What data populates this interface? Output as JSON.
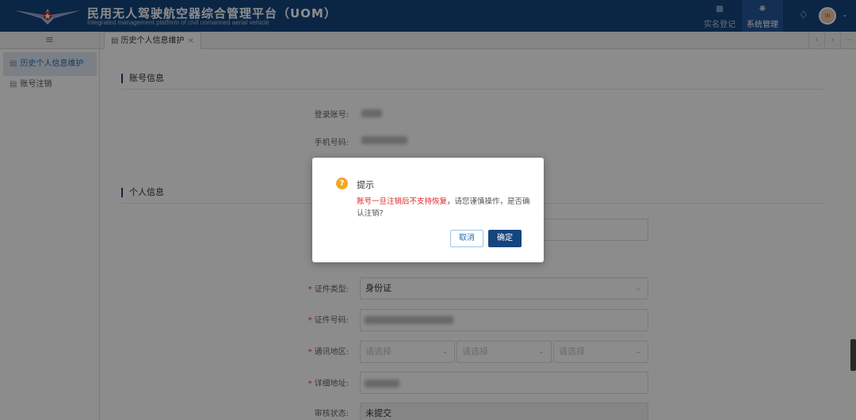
{
  "header": {
    "title": "民用无人驾驶航空器综合管理平台（UOM）",
    "subtitle": "Integrated management platform of civil unmanned aerial vehicle",
    "nav": [
      {
        "label": "实名登记",
        "icon": "document-icon"
      },
      {
        "label": "系统管理",
        "icon": "network-icon"
      }
    ],
    "avatar_initial": "w"
  },
  "tabs": [
    {
      "label": "历史个人信息维护"
    }
  ],
  "sidebar": {
    "items": [
      {
        "label": "历史个人信息维护"
      },
      {
        "label": "账号注销"
      }
    ]
  },
  "form": {
    "account_section": "账号信息",
    "personal_section": "个人信息",
    "login_label": "登录账号:",
    "phone_label": "手机号码:",
    "id_type_label": "证件类型:",
    "id_type_value": "身份证",
    "id_number_label": "证件号码:",
    "region_label": "通讯地区:",
    "region_placeholder": "请选择",
    "address_label": "详细地址:",
    "review_label": "审核状态:",
    "review_value": "未提交"
  },
  "dialog": {
    "title": "提示",
    "warning": "账号一旦注销后不支持恢复",
    "message": "，请您谨慎操作，是否确认注销?",
    "cancel": "取消",
    "confirm": "确定"
  },
  "colors": {
    "brand": "#14467e",
    "warning_text": "#e02020",
    "warning_icon": "#f5a623"
  }
}
